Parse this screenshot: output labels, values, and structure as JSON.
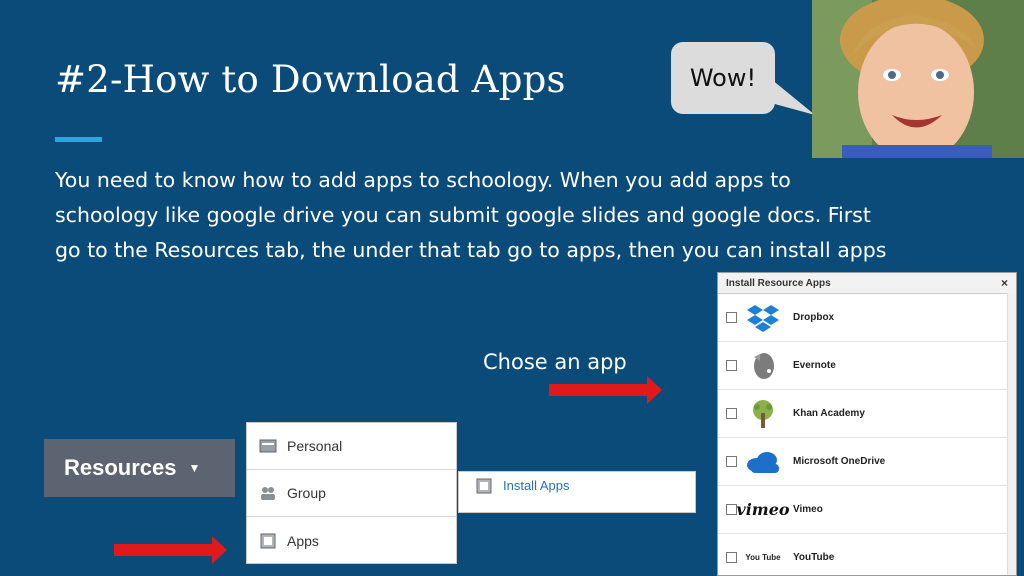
{
  "slide": {
    "title": "#2-How to Download Apps",
    "body_lines": [
      "You need  to know how to add apps to schoology. When you add apps to",
      "schoology like google drive you can submit google slides and google docs. First",
      "go to the Resources tab, the under that  tab go to apps, then you can install apps"
    ],
    "bubble_text": "Wow!",
    "chose_label": "Chose an app"
  },
  "resources_button": {
    "label": "Resources"
  },
  "dropdown": {
    "items": [
      {
        "label": "Personal",
        "icon": "personal-folder-icon"
      },
      {
        "label": "Group",
        "icon": "group-people-icon"
      },
      {
        "label": "Apps",
        "icon": "apps-icon"
      }
    ]
  },
  "submenu": {
    "label": "Install Apps",
    "icon": "apps-icon"
  },
  "install_panel": {
    "title": "Install Resource Apps",
    "close": "×",
    "apps": [
      {
        "name": "Dropbox",
        "icon": "dropbox-icon"
      },
      {
        "name": "Evernote",
        "icon": "evernote-icon"
      },
      {
        "name": "Khan Academy",
        "icon": "khan-academy-icon"
      },
      {
        "name": "Microsoft OneDrive",
        "icon": "onedrive-icon"
      },
      {
        "name": "Vimeo",
        "icon": "vimeo-icon",
        "logo_text": "vimeo"
      },
      {
        "name": "YouTube",
        "icon": "youtube-icon",
        "logo_text": "You Tube"
      }
    ]
  },
  "colors": {
    "background": "#0b4b7a",
    "accent": "#29a8e0",
    "arrow": "#e0191a",
    "resources_button": "#5b6470"
  }
}
